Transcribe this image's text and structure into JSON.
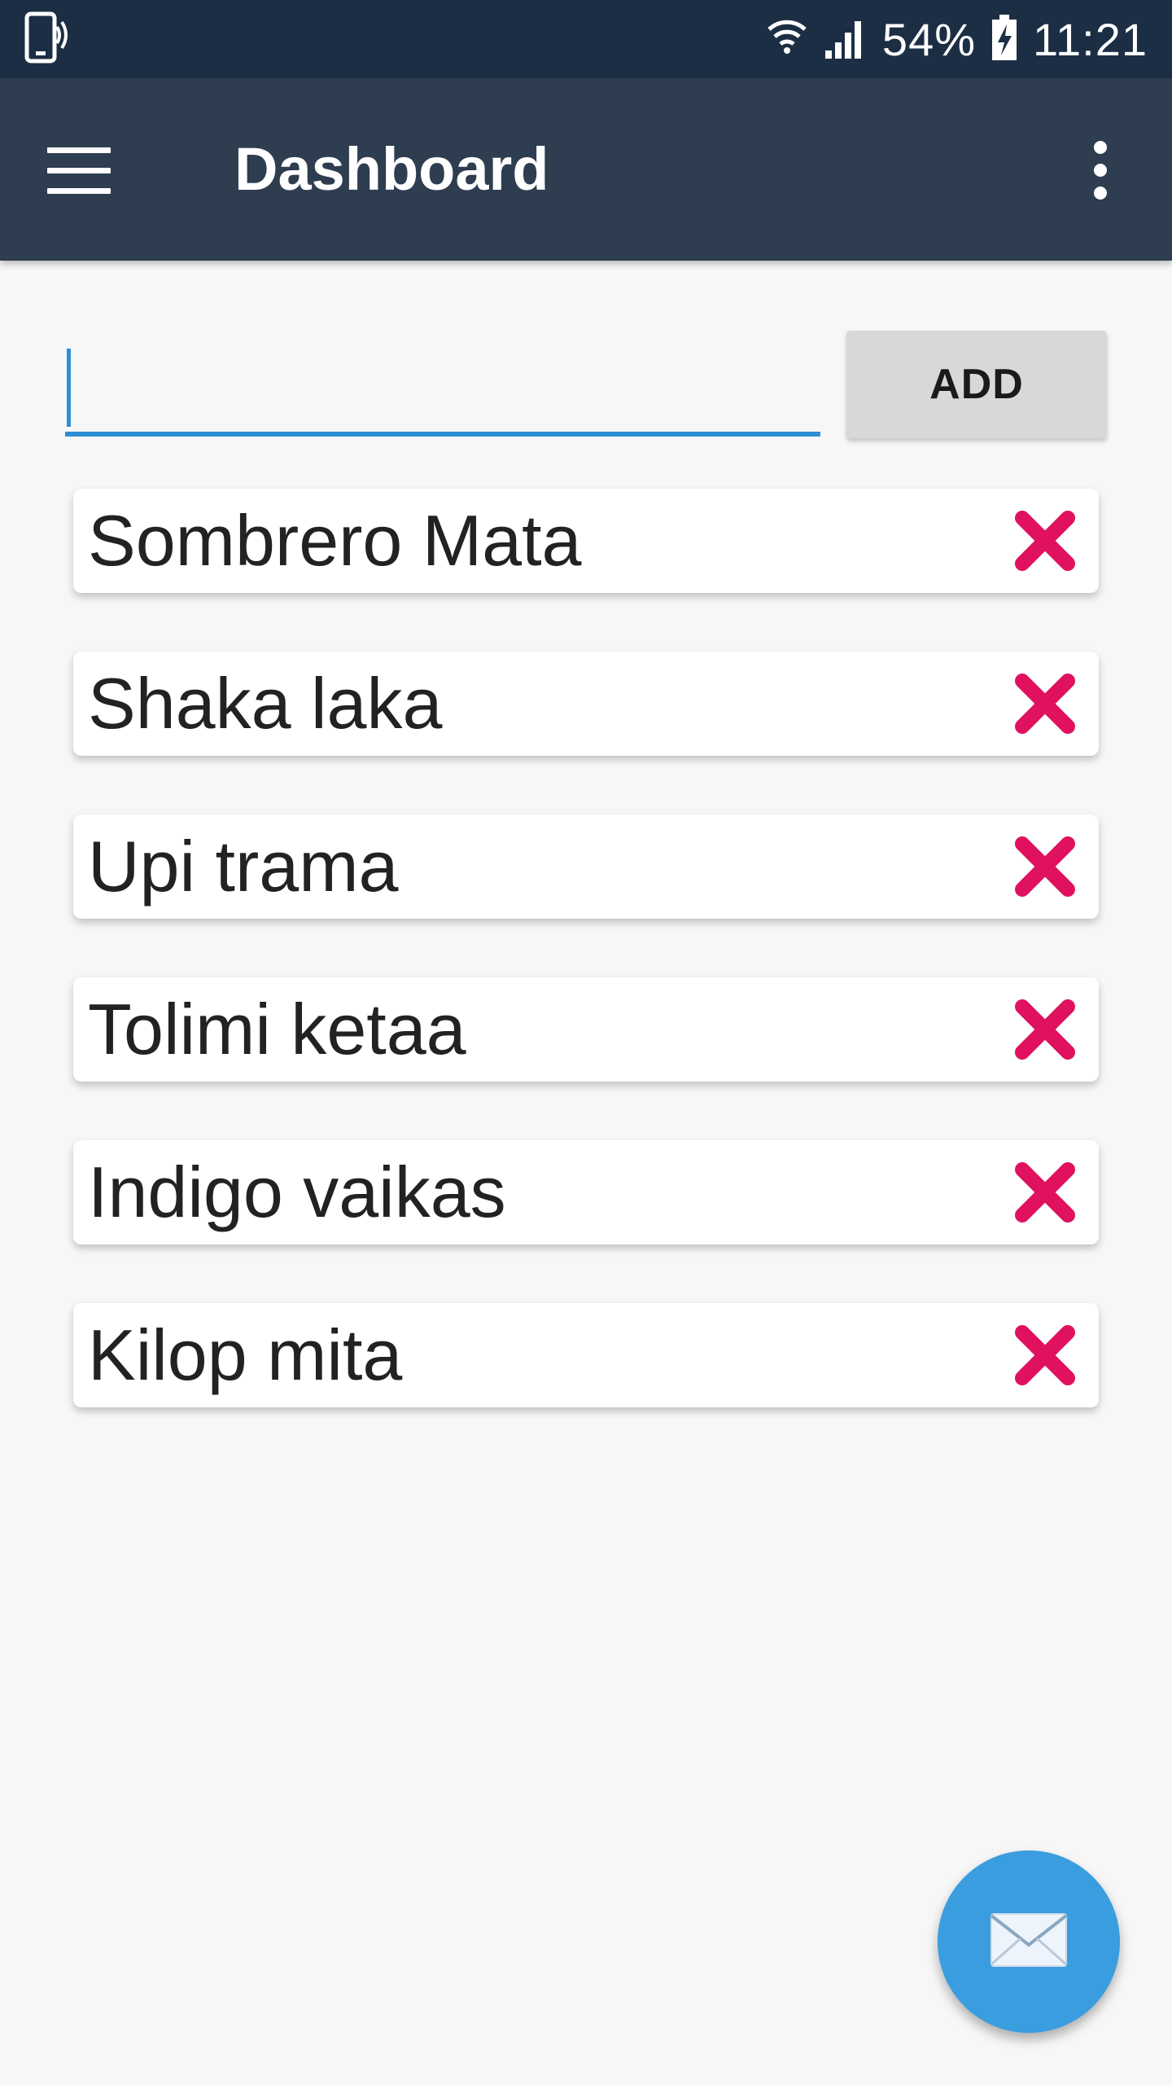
{
  "status_bar": {
    "battery": "54%",
    "time": "11:21"
  },
  "app_bar": {
    "title": "Dashboard",
    "menu_icon": "hamburger-menu-icon",
    "overflow_icon": "more-vert-icon"
  },
  "form": {
    "input_value": "",
    "input_placeholder": "",
    "add_label": "ADD"
  },
  "items": [
    {
      "label": "Sombrero Mata"
    },
    {
      "label": "Shaka laka"
    },
    {
      "label": "Upi trama"
    },
    {
      "label": "Tolimi ketaa"
    },
    {
      "label": "Indigo vaikas"
    },
    {
      "label": "Kilop mita"
    }
  ],
  "delete_icon": "close-x-icon",
  "fab_icon": "mail-icon",
  "colors": {
    "status_bar": "#1c2e44",
    "app_bar": "#2e3d50",
    "accent": "#2f8fd4",
    "delete": "#e0115f",
    "fab": "#3a9ddf"
  }
}
